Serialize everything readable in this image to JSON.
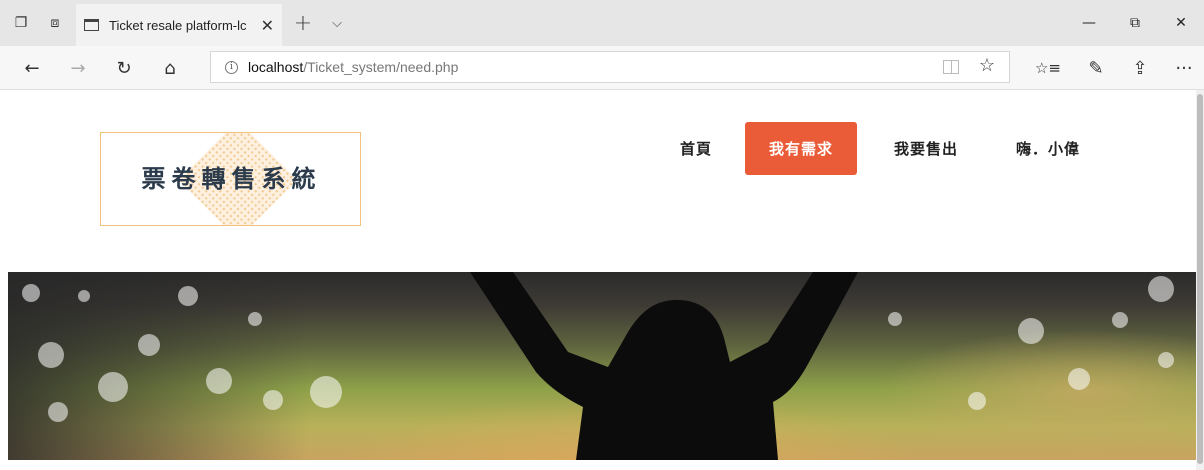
{
  "browser": {
    "tab_title": "Ticket resale platform-lc",
    "address_host": "localhost",
    "address_path": "/Ticket_system/need.php",
    "icons": {
      "tab_actions": "tab-actions-icon",
      "set_aside": "set-aside-tabs-icon",
      "tab_favicon": "page-icon",
      "close_tab": "close-icon",
      "new_tab": "plus-icon",
      "tab_list": "chevron-down-icon",
      "minimize": "minimize-icon",
      "restore": "restore-icon",
      "close_window": "close-icon",
      "back": "arrow-left-icon",
      "forward": "arrow-right-icon",
      "refresh": "refresh-icon",
      "home": "home-icon",
      "site_info": "info-icon",
      "reading_view": "book-icon",
      "favorite": "star-icon",
      "favorites_hub": "favorites-list-icon",
      "ink": "pen-icon",
      "share": "share-icon",
      "more": "more-icon"
    },
    "glyphs": {
      "close": "✕",
      "new_tab": "+",
      "tab_list": "⌵",
      "minimize": "—",
      "restore": "⧉",
      "back": "←",
      "forward": "→",
      "refresh": "↻",
      "home": "⌂",
      "info": "i",
      "star": "☆",
      "favorites_hub": "☆≡",
      "ink": "✎",
      "share": "⇪",
      "more": "···",
      "tab_actions": "❐",
      "set_aside": "⧈"
    }
  },
  "site": {
    "logo_text": "票卷轉售系統",
    "nav": [
      {
        "label": "首頁",
        "active": false
      },
      {
        "label": "我有需求",
        "active": true
      },
      {
        "label": "我要售出",
        "active": false
      },
      {
        "label": "嗨．小偉",
        "active": false
      }
    ],
    "colors": {
      "accent": "#ea5b37",
      "logo_border": "#f2c27c",
      "logo_text": "#2b3b4b"
    }
  }
}
